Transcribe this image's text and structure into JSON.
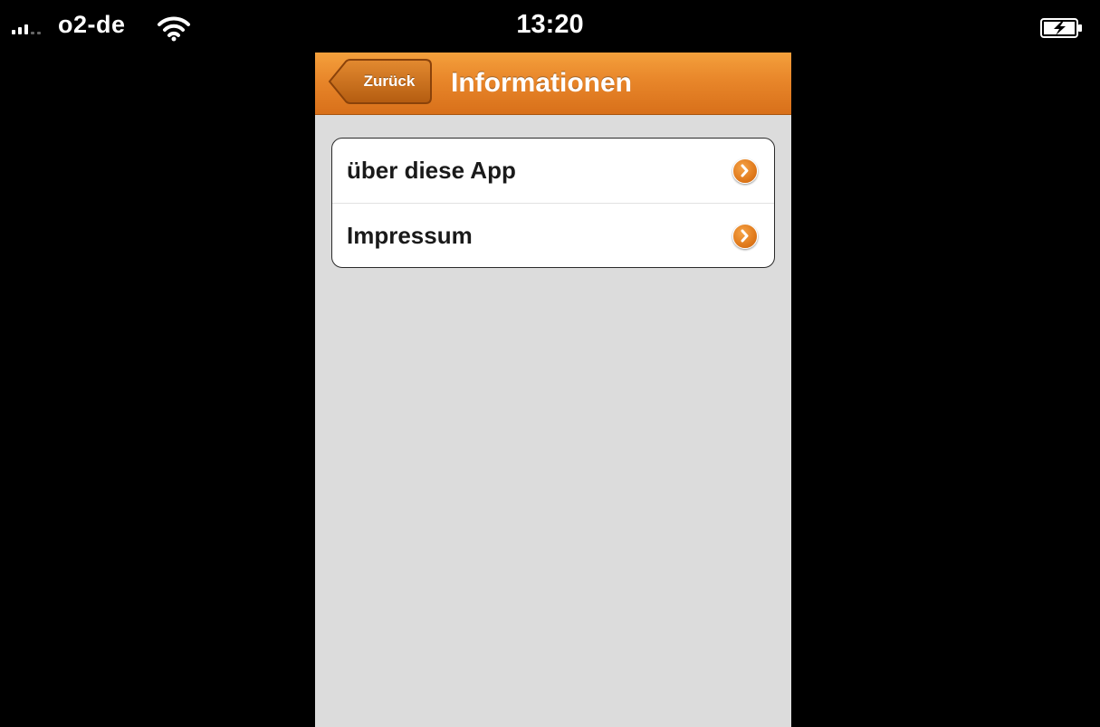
{
  "status_bar": {
    "carrier": "o2-de",
    "time": "13:20",
    "signal_bars": 3,
    "icons": [
      "signal-icon",
      "wifi-icon",
      "battery-charging-icon"
    ]
  },
  "nav": {
    "back_label": "Zurück",
    "title": "Informationen",
    "accent_color": "#e8862a"
  },
  "list": {
    "items": [
      {
        "label": "über diese App",
        "icon": "disclosure-arrow-icon"
      },
      {
        "label": "Impressum",
        "icon": "disclosure-arrow-icon"
      }
    ]
  }
}
